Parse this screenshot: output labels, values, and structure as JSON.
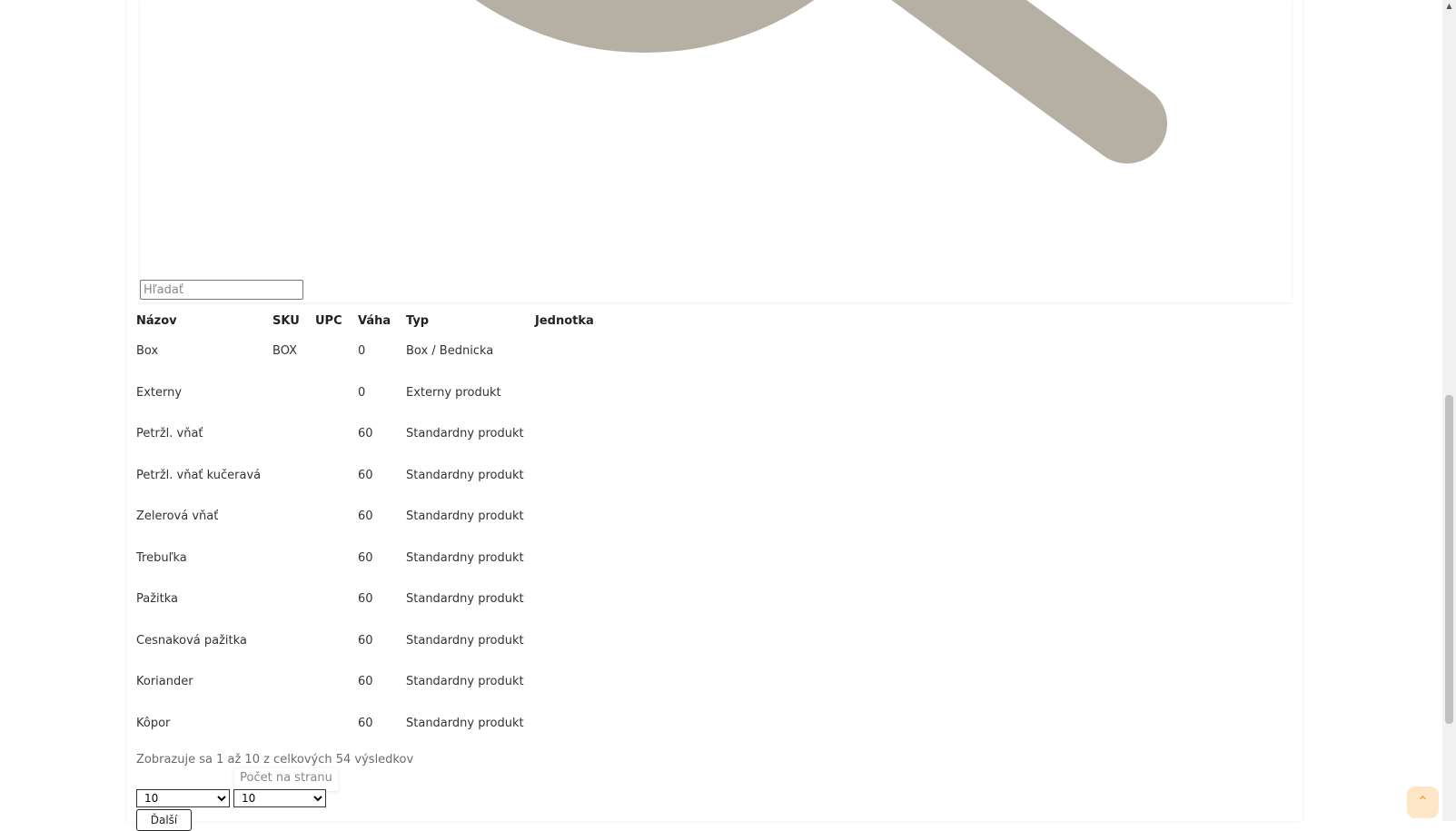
{
  "search": {
    "placeholder": "Hľadať"
  },
  "table": {
    "headers": [
      "Názov",
      "SKU",
      "UPC",
      "Váha",
      "Typ",
      "Jednotka"
    ],
    "rows": [
      [
        "Box",
        "BOX",
        "",
        "0",
        "Box / Bednicka",
        ""
      ],
      [
        "Externy",
        "",
        "",
        "0",
        "Externy produkt",
        ""
      ],
      [
        "Petržl. vňať",
        "",
        "",
        "60",
        "Standardny produkt",
        ""
      ],
      [
        "Petržl. vňať kučeravá",
        "",
        "",
        "60",
        "Standardny produkt",
        ""
      ],
      [
        "Zelerová vňať",
        "",
        "",
        "60",
        "Standardny produkt",
        ""
      ],
      [
        "Trebuľka",
        "",
        "",
        "60",
        "Standardny produkt",
        ""
      ],
      [
        "Pažitka",
        "",
        "",
        "60",
        "Standardny produkt",
        ""
      ],
      [
        "Cesnaková pažitka",
        "",
        "",
        "60",
        "Standardny produkt",
        ""
      ],
      [
        "Koriander",
        "",
        "",
        "60",
        "Standardny produkt",
        ""
      ],
      [
        "Kôpor",
        "",
        "",
        "60",
        "Standardny produkt",
        ""
      ]
    ]
  },
  "pagination": {
    "summary": "Zobrazuje sa 1 až 10 z celkových 54 výsledkov",
    "per_page_label": "Počet na stranu",
    "page_select_value": "10",
    "per_page_value": "10",
    "next_label": "Ďalší"
  },
  "colors": {
    "search_icon_fill": "#b5b0a3",
    "scroll_top_bg": "#fde7c7",
    "scroll_top_arrow": "#f5a04a"
  },
  "icons": {
    "large_image": "search-icon",
    "scroll_to_top": "chevron-up-icon"
  }
}
